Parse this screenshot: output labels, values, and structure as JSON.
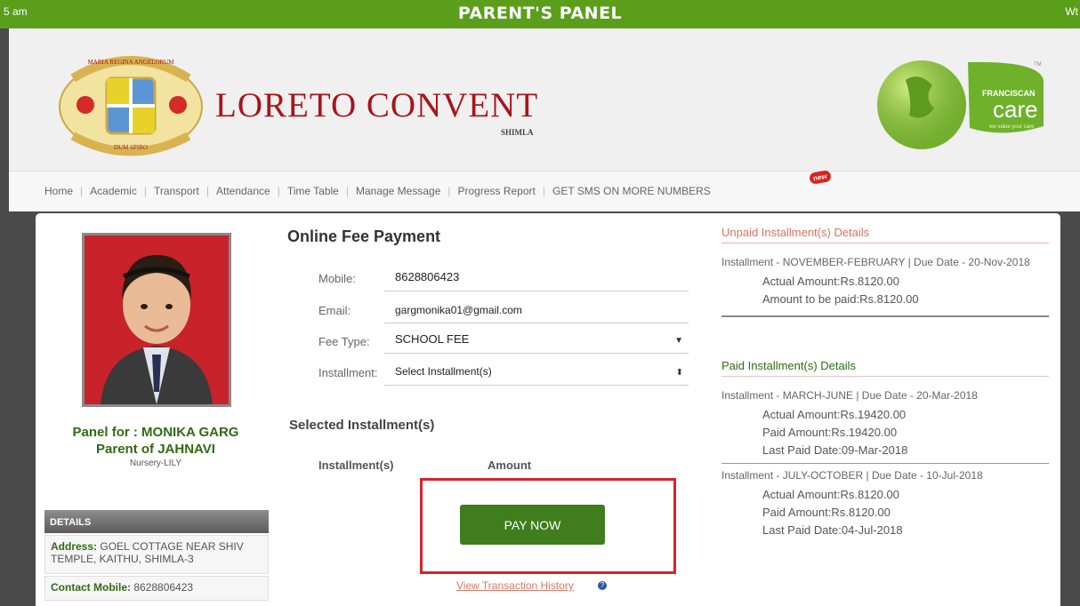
{
  "topbar": {
    "left_ticker": "5 am",
    "title": "PARENT'S PANEL",
    "right_ticker": "Wt",
    "bg_color": "#5a9e1a"
  },
  "header": {
    "school_name": "LORETO CONVENT",
    "school_city": "SHIMLA",
    "logo_motto_top": "MARIA REGINA ANGELORUM",
    "logo_motto_bottom": "DUM SPIRO",
    "care_logo_brand": "FRANCISCAN",
    "care_logo_text": "care",
    "care_logo_tagline": "we value your care",
    "care_logo_tm": "TM"
  },
  "nav": {
    "items": [
      {
        "label": "Home"
      },
      {
        "label": "Academic"
      },
      {
        "label": "Transport"
      },
      {
        "label": "Attendance"
      },
      {
        "label": "Time Table"
      },
      {
        "label": "Manage Message"
      },
      {
        "label": "Progress Report"
      },
      {
        "label": "GET SMS ON MORE NUMBERS"
      }
    ],
    "new_badge": "new"
  },
  "profile": {
    "panel_for": "Panel for : MONIKA GARG",
    "parent_of": "Parent of JAHNAVI",
    "class": "Nursery-LILY",
    "details_title": "DETAILS",
    "address_label": "Address:",
    "address_value": "GOEL COTTAGE NEAR SHIV TEMPLE, KAITHU, SHIMLA-3",
    "mobile_label": "Contact Mobile:",
    "mobile_value": "8628806423"
  },
  "payment": {
    "title": "Online Fee Payment",
    "mobile_label": "Mobile:",
    "mobile_value": "8628806423",
    "email_label": "Email:",
    "email_value": "gargmonika01@gmail.com",
    "fee_type_label": "Fee Type:",
    "fee_type_value": "SCHOOL FEE",
    "installment_label": "Installment:",
    "installment_value": "Select Installment(s)",
    "selected_title": "Selected Installment(s)",
    "col_installments": "Installment(s)",
    "col_amount": "Amount",
    "pay_button": "PAY NOW",
    "history_link": "View Transaction History",
    "highlight_color": "#d8232a"
  },
  "unpaid": {
    "title": "Unpaid Installment(s) Details",
    "items": [
      {
        "heading": "Installment - NOVEMBER-FEBRUARY | Due Date - 20-Nov-2018",
        "actual": "Actual Amount:Rs.8120.00",
        "to_pay": "Amount to be paid:Rs.8120.00"
      }
    ]
  },
  "paid": {
    "title": "Paid Installment(s) Details",
    "items": [
      {
        "heading": "Installment - MARCH-JUNE | Due Date - 20-Mar-2018",
        "actual": "Actual Amount:Rs.19420.00",
        "paid": "Paid Amount:Rs.19420.00",
        "last_paid": "Last Paid Date:09-Mar-2018"
      },
      {
        "heading": "Installment - JULY-OCTOBER | Due Date - 10-Jul-2018",
        "actual": "Actual Amount:Rs.8120.00",
        "paid": "Paid Amount:Rs.8120.00",
        "last_paid": "Last Paid Date:04-Jul-2018"
      }
    ]
  }
}
